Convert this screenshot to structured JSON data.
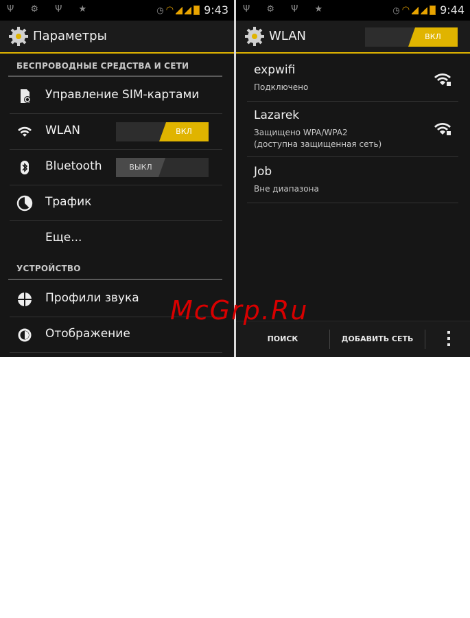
{
  "left_screen": {
    "statusbar": {
      "left_icons": "Ψ ⚙ Ψ ★",
      "time": "9:43"
    },
    "title": "Параметры",
    "sections": {
      "wireless": "БЕСПРОВОДНЫЕ СРЕДСТВА И СЕТИ",
      "device": "УСТРОЙСТВО"
    },
    "items": {
      "sim": "Управление SIM-картами",
      "wlan": "WLAN",
      "wlan_toggle": "ВКЛ",
      "bluetooth": "Bluetooth",
      "bluetooth_toggle": "ВЫКЛ",
      "traffic": "Трафик",
      "more": "Еще...",
      "sound": "Профили звука",
      "display": "Отображение"
    }
  },
  "right_screen": {
    "statusbar": {
      "left_icons": "Ψ ⚙ Ψ ★",
      "time": "9:44"
    },
    "title": "WLAN",
    "toggle": "ВКЛ",
    "networks": [
      {
        "name": "expwifi",
        "status": "Подключено"
      },
      {
        "name": "Lazarek",
        "status": "Защищено WPA/WPA2",
        "status2": "(доступна защищенная сеть)"
      },
      {
        "name": "Job",
        "status": "Вне диапазона"
      }
    ],
    "bottom": {
      "search": "ПОИСК",
      "add": "ДОБАВИТЬ СЕТЬ"
    }
  },
  "watermark": "McGrp.Ru",
  "colors": {
    "accent": "#e0b400",
    "background": "#161616",
    "watermark": "#d80000"
  },
  "icons": [
    "settings-gear-icon",
    "sim-card-icon",
    "wifi-icon",
    "bluetooth-icon",
    "traffic-icon",
    "sound-profile-icon",
    "display-icon",
    "overflow-menu-icon"
  ]
}
